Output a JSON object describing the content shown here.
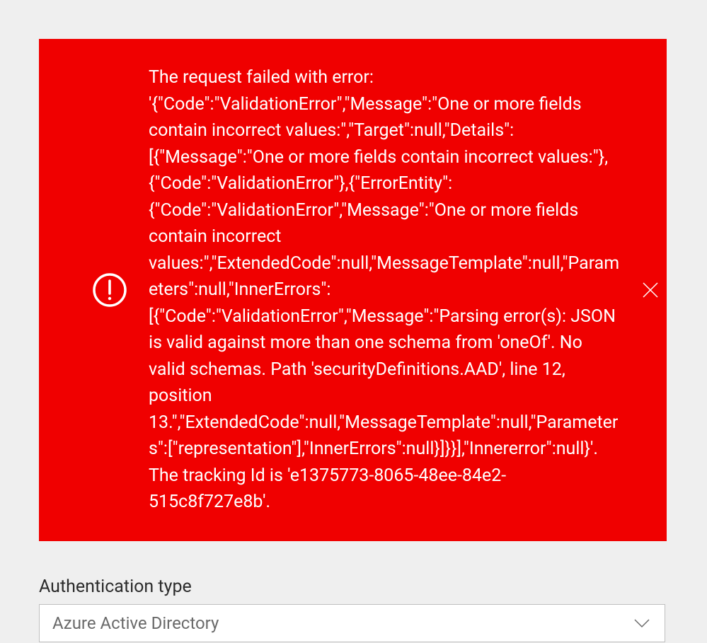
{
  "error": {
    "message": "The request failed with error: '{\"Code\":\"ValidationError\",\"Message\":\"One or more fields contain incorrect values:\",\"Target\":null,\"Details\":[{\"Message\":\"One or more fields contain incorrect values:\"},{\"Code\":\"ValidationError\"},{\"ErrorEntity\":{\"Code\":\"ValidationError\",\"Message\":\"One or more fields contain incorrect values:\",\"ExtendedCode\":null,\"MessageTemplate\":null,\"Parameters\":null,\"InnerErrors\":[{\"Code\":\"ValidationError\",\"Message\":\"Parsing error(s): JSON is valid against more than one schema from 'oneOf'. No valid schemas. Path 'securityDefinitions.AAD', line 12, position 13.\",\"ExtendedCode\":null,\"MessageTemplate\":null,\"Parameters\":[\"representation\"],\"InnerErrors\":null}]}}],\"Innererror\":null}'. The tracking Id is 'e1375773-8065-48ee-84e2-515c8f727e8b'."
  },
  "form": {
    "authTypeLabel": "Authentication type",
    "authTypeValue": "Azure Active Directory"
  },
  "colors": {
    "errorBackground": "#f00000",
    "errorText": "#ffffff",
    "pageBackground": "#efefef",
    "inputBorder": "#bfbfbf",
    "labelText": "#2b2b2b",
    "valueText": "#6a6a6a"
  }
}
